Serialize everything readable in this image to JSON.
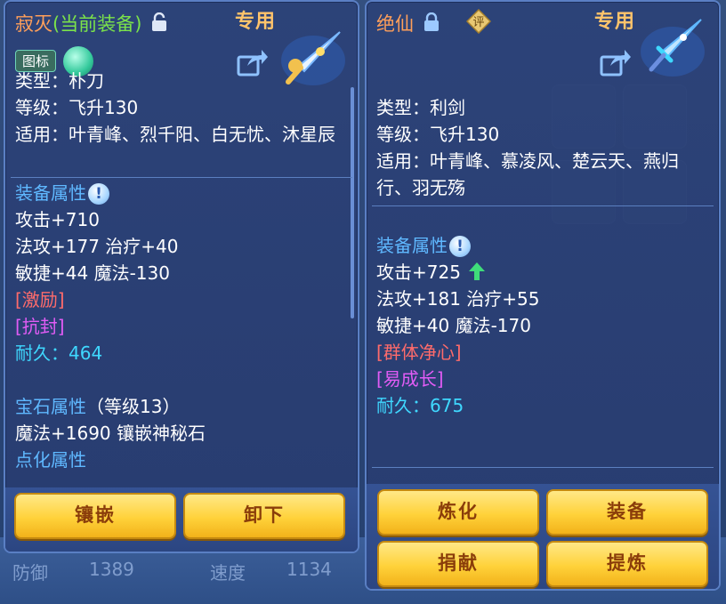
{
  "left_panel": {
    "name": "寂灭",
    "name_suffix": "(当前装备)",
    "special_tag": "专用",
    "badge_label": "图标",
    "type": "类型：朴刀",
    "level": "等级：飞升130",
    "applicable": "适用：叶青峰、烈千阳、白无忧、沐星辰",
    "attr_header": "装备属性",
    "stats": [
      "攻击+710",
      "法攻+177 治疗+40",
      "敏捷+44 魔法-130"
    ],
    "special_effect": "[激励]",
    "special_skill": "[抗封]",
    "durability": "耐久：464",
    "gem_header": "宝石属性",
    "gem_level": "（等级13）",
    "gem_stat": "魔法+1690 镶嵌神秘石",
    "refine_header": "点化属性",
    "buttons": [
      "镶嵌",
      "卸下"
    ]
  },
  "right_panel": {
    "name": "绝仙",
    "special_tag": "专用",
    "rate_badge": "评",
    "type": "类型：利剑",
    "level": "等级：飞升130",
    "applicable": "适用：叶青峰、慕凌风、楚云天、燕归行、羽无殇",
    "attr_header": "装备属性",
    "stats": [
      "攻击+725",
      "法攻+181 治疗+55",
      "敏捷+40 魔法-170"
    ],
    "special_effect": "[群体净心]",
    "special_skill": "[易成长]",
    "durability": "耐久：675",
    "buttons": [
      "炼化",
      "装备",
      "捐献",
      "提炼"
    ]
  },
  "background": {
    "stats": [
      "防御",
      "1389",
      "速度",
      "1134"
    ]
  },
  "colors": {
    "panel_bg": "#2c4278",
    "header_blue": "#5fb8ff",
    "durability_cyan": "#3fd8ff",
    "effect_red": "#ff6b6b",
    "skill_magenta": "#e15cf5",
    "button_gold": "#ffd23a"
  }
}
